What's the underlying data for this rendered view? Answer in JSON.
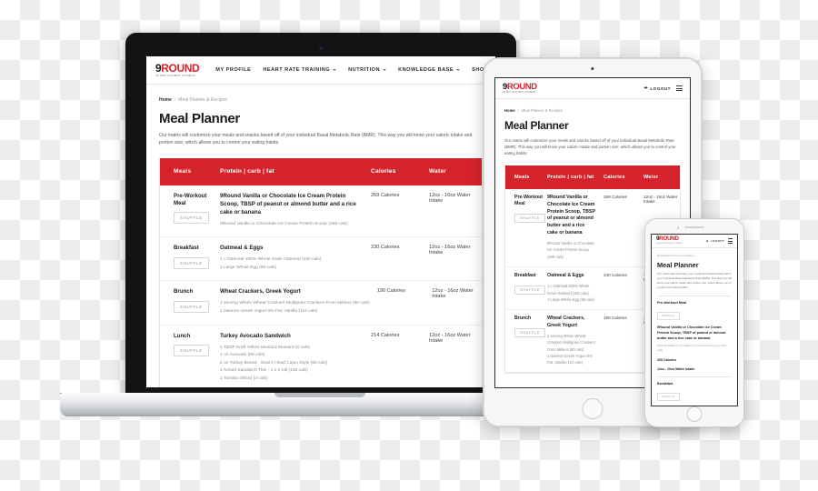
{
  "brand": {
    "logo_primary": "9",
    "logo_secondary": "ROUND",
    "logo_tagline": "30 MIN KICKBOX FITNESS",
    "accent_red": "#d5232c",
    "logo_dark": "#111111"
  },
  "nav": {
    "items": [
      {
        "label": "MY PROFILE",
        "has_dropdown": false
      },
      {
        "label": "HEART RATE TRAINING",
        "has_dropdown": true
      },
      {
        "label": "NUTRITION",
        "has_dropdown": true
      },
      {
        "label": "KNOWLEDGE BASE",
        "has_dropdown": true
      },
      {
        "label": "SHOP",
        "has_dropdown": false
      }
    ],
    "logout_label": "LOGOUT"
  },
  "page": {
    "breadcrumb_home": "Home",
    "breadcrumb_sep": "/",
    "breadcrumb_current": "Meal Planner & Recipes",
    "title": "Meal Planner",
    "intro_desktop": "Our matrix will customize your meals and snacks based off of your individual Basal Metabolic Rate (BMR). This way you will know your caloric intake and portion size, which allows you to control your eating habits.",
    "intro_short": "Our matrix will customize your meals and snacks based off of your individual Basal Metabolic Rate (BMR). This way you will know your caloric intake and portion size, which allows you to control your eating habits."
  },
  "table": {
    "headers": {
      "meals": "Meals",
      "macros": "Protein | carb | fat",
      "calories": "Calories",
      "water": "Water"
    },
    "shuffle_label": "SHUFFLE",
    "rows": [
      {
        "meal": "Pre-Workout Meal",
        "meal_wrapped": "Pre-Workout\nMeal",
        "title": "9Round Vanilla or Chocolate Ice Cream Protein Scoop, TBSP of peanut or almond butter and a rice cake or banana",
        "items": [
          "9Round Vanilla or Chocolate Ice Cream Protein Scoop (269 cals)"
        ],
        "calories": "269 Calories",
        "water": "12oz - 16oz Water Intake"
      },
      {
        "meal": "Breakfast",
        "meal_wrapped": "Breakfast",
        "title": "Oatmeal & Eggs",
        "items": [
          "1 c Oatmeal 100% Whole Grain Oatmeal (150 cals)",
          "1 Large Whole Egg (80 cals)"
        ],
        "calories": "230 Calories",
        "water": "12oz - 16oz Water Intake"
      },
      {
        "meal": "Brunch",
        "meal_wrapped": "Brunch",
        "title": "Wheat Crackers, Greek Yogurt",
        "items": [
          "1 serving Whole Wheat Crackers Multigrain Crackers From Miltons (80 cals)",
          "1 Dannon Greek Yogurt 0% Fat, Vanilla (110 cals)"
        ],
        "calories": "190 Calories",
        "water": "12oz - 16oz Water Intake"
      },
      {
        "meal": "Lunch",
        "meal_wrapped": "Lunch",
        "title": "Turkey Avocado Sandwich",
        "items": [
          "1 TBSP Kraft Yellow Mustard Mustard (0 cals)",
          "1 oz Avocado (50 cals)",
          "2 oz Turkey Breast - Boar's Head Cajun Style (60 cals)",
          "1 Arnold Sandwich Thin - 1 x 1 roll (100 cals)",
          "1 Tomato (Slice) (4 cals)"
        ],
        "calories": "214 Calories",
        "water": "12oz - 16oz Water Intake"
      }
    ]
  },
  "phone_view": {
    "meal_label": "Pre-Workout Meal",
    "shuffle_label": "SHUFFLE",
    "title": "9Round Vanilla or Chocolate Ice Cream Protein Scoop, TBSP of peanut or almond butter and a rice cake or banana",
    "item": "9Round Vanilla or Chocolate Ice Cream Protein Scoop (269 cals)",
    "calories": "269 Calories",
    "water": "12oz - 16oz Water Intake",
    "next_meal": "Breakfast"
  }
}
